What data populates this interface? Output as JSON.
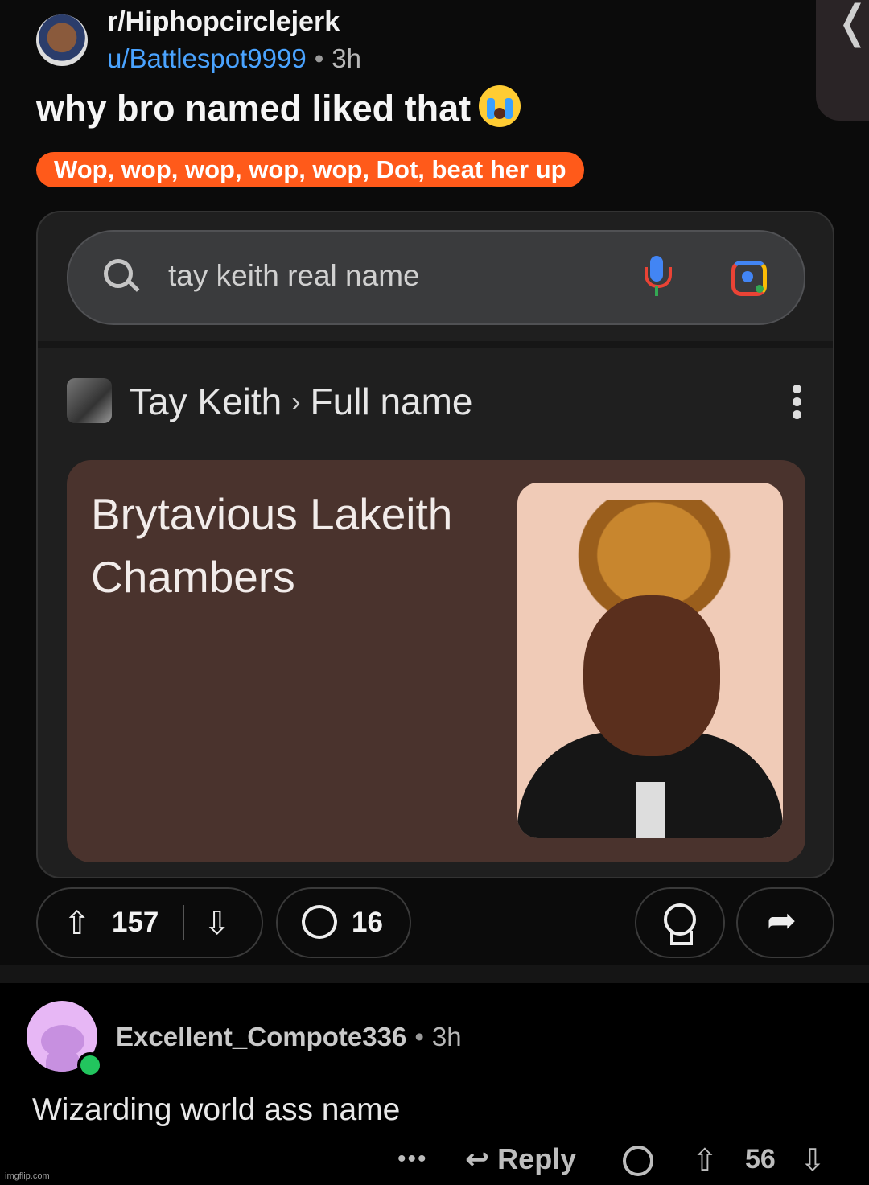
{
  "post": {
    "subreddit": "r/Hiphopcirclejerk",
    "author": "u/Battlespot9999",
    "time": "3h",
    "title": "why bro named liked that",
    "flair": "Wop, wop, wop, wop, wop, Dot, beat her up",
    "upvotes": "157",
    "comments": "16"
  },
  "embed": {
    "query": "tay keith real name",
    "entity": "Tay Keith",
    "attribute": "Full name",
    "answer": "Brytavious Lakeith Chambers"
  },
  "comment": {
    "author": "Excellent_Compote336",
    "time": "3h",
    "body": "Wizarding world ass name",
    "reply_label": "Reply",
    "score": "56"
  },
  "watermark": "imgflip.com"
}
